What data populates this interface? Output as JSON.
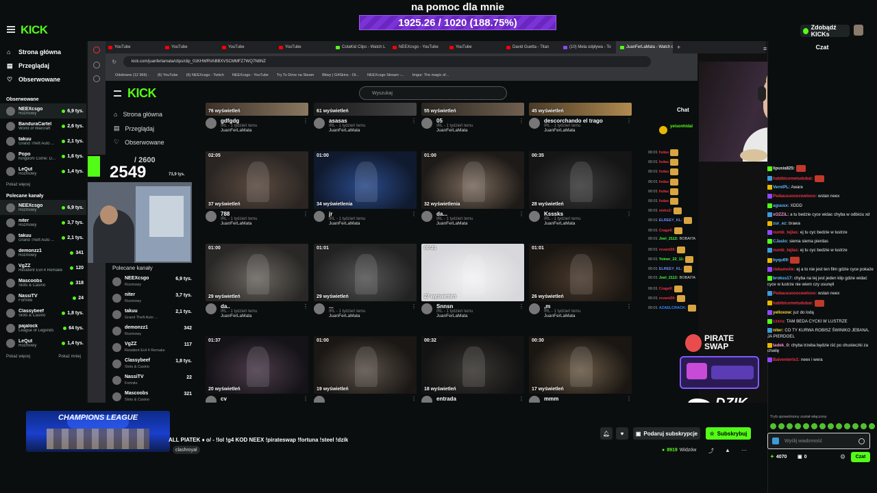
{
  "goal": {
    "title": "na pomoc dla mnie",
    "progress_text": "1925.26 / 1020 (188.75%)"
  },
  "topbar": {
    "logo": "KICK",
    "kicks_button": "Zdobądź KICKs"
  },
  "sidebar": {
    "nav": [
      {
        "label": "Strona główna",
        "icon": "home-icon"
      },
      {
        "label": "Przeglądaj",
        "icon": "browse-icon"
      },
      {
        "label": "Obserwowane",
        "icon": "heart-icon"
      }
    ],
    "followed_title": "Obserwowane",
    "followed": [
      {
        "name": "NEEXcsgo",
        "cat": "Rozmowy",
        "viewers": "6,9 tys.",
        "active": true
      },
      {
        "name": "BanduraCartel",
        "cat": "World of Warcraft",
        "viewers": "2,6 tys."
      },
      {
        "name": "takuu",
        "cat": "Grand Theft Auto ...",
        "viewers": "2,1 tys."
      },
      {
        "name": "Popo",
        "cat": "Kingdom Come: D...",
        "viewers": "1,6 tys."
      },
      {
        "name": "LeQut",
        "cat": "Rozmowy",
        "viewers": "1,4 tys."
      }
    ],
    "show_more": "Pokaż więcej",
    "recommended_title": "Polecane kanały",
    "recommended": [
      {
        "name": "NEEXcsgo",
        "cat": "Rozmowy",
        "viewers": "6,9 tys.",
        "active": true
      },
      {
        "name": "niter",
        "cat": "Rozmowy",
        "viewers": "3,7 tys."
      },
      {
        "name": "takuu",
        "cat": "Grand Theft Auto ...",
        "viewers": "2,1 tys."
      },
      {
        "name": "demonzz1",
        "cat": "Rozmowy",
        "viewers": "341"
      },
      {
        "name": "VgZZ",
        "cat": "Resident Evil 4 Remake",
        "viewers": "120"
      },
      {
        "name": "Mascoobs",
        "cat": "Slots & Casino",
        "viewers": "318"
      },
      {
        "name": "NassiTV",
        "cat": "Fortnite",
        "viewers": "24"
      },
      {
        "name": "Classybeef",
        "cat": "Slots & Casino",
        "viewers": "1,8 tys."
      },
      {
        "name": "pajalock",
        "cat": "League of Legends",
        "viewers": "64 tys."
      },
      {
        "name": "LeQut",
        "cat": "Rozmowy",
        "viewers": "1,4 tys."
      }
    ],
    "show_less": "Pokaż mniej"
  },
  "browser": {
    "tabs": [
      {
        "label": "YouTube",
        "fav": "r"
      },
      {
        "label": "YouTube",
        "fav": "r"
      },
      {
        "label": "YouTube",
        "fav": "r"
      },
      {
        "label": "YouTube",
        "fav": "r"
      },
      {
        "label": "CotaKid Clips - Watch L",
        "fav": "g"
      },
      {
        "label": "NEEXcsgo - YouTube",
        "fav": "r"
      },
      {
        "label": "YouTube",
        "fav": "r"
      },
      {
        "label": "David Guetta - Titan",
        "fav": "r"
      },
      {
        "label": "(10) Mela odpływa - To",
        "fav": "p"
      },
      {
        "label": "JuanFerLaMata - Watch c",
        "fav": "g",
        "active": true
      }
    ],
    "url": "kick.com/juanferlamata/clips/clip_01KHWRVABBXVSCMMFZ7WQ7N8NZ",
    "bookmarks": [
      "Odebrane (12 966) -",
      "(6) YouTube",
      "(6) NEEXcsgo - Twitch",
      "NEEXcsgo - YouTube",
      "Try To Drive na Steam",
      "Bitwy | G4Skins - Ot...",
      "NEEXcsgo Stream -...",
      "Imgur: The magic of..."
    ]
  },
  "inner": {
    "logo": "KICK",
    "search_placeholder": "Wyszukaj",
    "nav": [
      "Strona główna",
      "Przeglądaj",
      "Obserwowane"
    ],
    "rec_title": "Polecane kanały",
    "rec": [
      {
        "name": "NEEXcsgo",
        "cat": "Rozmowy",
        "viewers": "6,9 tys."
      },
      {
        "name": "niter",
        "cat": "Rozmowy",
        "viewers": "3,7 tys."
      },
      {
        "name": "takuu",
        "cat": "Grand Theft Auto ...",
        "viewers": "2,1 tys."
      },
      {
        "name": "demonzz1",
        "cat": "Rozmowy",
        "viewers": "342"
      },
      {
        "name": "VgZZ",
        "cat": "Resident Evil 4 Remake",
        "viewers": "117"
      },
      {
        "name": "Classybeef",
        "cat": "Slots & Casino",
        "viewers": "1,8 tys."
      },
      {
        "name": "NassiTV",
        "cat": "Fortnite",
        "viewers": "22"
      },
      {
        "name": "Mascoobs",
        "cat": "Slots & Casino",
        "viewers": "321"
      }
    ],
    "clips": [
      {
        "dur": "",
        "views": "76 wyświetleń",
        "title": "gdfgdg",
        "author": "JuanFerLaMata"
      },
      {
        "dur": "",
        "views": "61 wyświetleń",
        "title": "asasas",
        "author": "JuanFerLaMata"
      },
      {
        "dur": "",
        "views": "55 wyświetleń",
        "title": "05",
        "author": "JuanFerLaMata"
      },
      {
        "dur": "",
        "views": "45 wyświetleń",
        "title": "descorchando el trago",
        "author": "JuanFerLaMata"
      },
      {
        "dur": "02:05",
        "views": "37 wyświetleń",
        "title": "788",
        "author": "JuanFerLaMata"
      },
      {
        "dur": "01:00",
        "views": "34 wyświetlenia",
        "title": "jr",
        "author": "JuanFerLaMata"
      },
      {
        "dur": "01:00",
        "views": "32 wyświetlenia",
        "title": "da...",
        "author": "JuanFerLaMata"
      },
      {
        "dur": "00:35",
        "views": "28 wyświetleń",
        "title": "Ksssks",
        "author": "JuanFerLaMata"
      },
      {
        "dur": "01:00",
        "views": "29 wyświetleń",
        "title": "da..",
        "author": "JuanFerLaMata"
      },
      {
        "dur": "01:01",
        "views": "29 wyświetleń",
        "title": "...",
        "author": "JuanFerLaMata"
      },
      {
        "dur": "00:21",
        "views": "27 wyświetleń",
        "title": "Snnsn",
        "author": "JuanFerLaMata"
      },
      {
        "dur": "01:01",
        "views": "26 wyświetleń",
        "title": ",m",
        "author": "JuanFerLaMata"
      },
      {
        "dur": "01:37",
        "views": "20 wyświetleń",
        "title": "cv",
        "author": ""
      },
      {
        "dur": "01:00",
        "views": "19 wyświetleń",
        "title": "",
        "author": ""
      },
      {
        "dur": "00:32",
        "views": "18 wyświetleń",
        "title": "entrada",
        "author": ""
      },
      {
        "dur": "00:30",
        "views": "17 wyświetleń",
        "title": "mmm",
        "author": ""
      }
    ],
    "clip_sub": "IRL - 1 tydzień temu",
    "chat_title": "Chat",
    "chat_user": "yeisonhidal",
    "chat_lines": [
      {
        "t": "00:01",
        "u": "fsdas",
        "c": "#e34"
      },
      {
        "t": "00:01",
        "u": "fsdas",
        "c": "#e34"
      },
      {
        "t": "00:01",
        "u": "fsdas",
        "c": "#e34"
      },
      {
        "t": "00:01",
        "u": "fsdas",
        "c": "#e34"
      },
      {
        "t": "00:01",
        "u": "fsdas",
        "c": "#e34"
      },
      {
        "t": "00:01",
        "u": "fsdas",
        "c": "#e34"
      },
      {
        "t": "00:01",
        "u": "sieko2:",
        "c": "#e34"
      },
      {
        "t": "00:01",
        "u": "ELREEY_KL:",
        "c": "#6b8cff"
      },
      {
        "t": "00:01",
        "u": "Cragell:",
        "c": "#e34"
      },
      {
        "t": "00:01",
        "u": "Joel_2112:",
        "c": "#4f4",
        "text": "BOBAITA"
      },
      {
        "t": "00:01",
        "u": "revant26:",
        "c": "#e34"
      },
      {
        "t": "00:01",
        "u": "Yoiner_22_11:",
        "c": "#4f4"
      },
      {
        "t": "00:01",
        "u": "ELREEY_KL:",
        "c": "#6b8cff"
      },
      {
        "t": "00:01",
        "u": "Joel_2112:",
        "c": "#4f4",
        "text": "BOBAITA"
      },
      {
        "t": "00:01",
        "u": "Cragell:",
        "c": "#e34"
      },
      {
        "t": "00:01",
        "u": "revant26:",
        "c": "#e34"
      },
      {
        "t": "00:01",
        "u": "AZAELCRACK:",
        "c": "#38f"
      }
    ]
  },
  "overlay": {
    "count_small": "/ 2600",
    "count_big": "2549",
    "side_viewers": "73,9 tys.",
    "sponsor1": "PIRATE SWAP",
    "sponsor3": "DZIK",
    "cl_text": "CHAMPIONS LEAGUE"
  },
  "stream": {
    "title": "ALL PIATEK ♦ o/ - !lol !g4 KOD NEEX !pirateswap !fortuna !steel !dzik",
    "tag": "clashroyal",
    "gift_sub": "Podaruj subskrypcje",
    "subscribe": "Subskrybuj",
    "viewers": "8919",
    "viewers_label": "Widzów"
  },
  "chat": {
    "title": "Czat",
    "messages": [
      {
        "u": "lipusia825:",
        "c": "#e0e0e0",
        "text": ""
      },
      {
        "u": "habibicometudubai:",
        "c": "#e34",
        "text": ""
      },
      {
        "u": "VerniPL:",
        "c": "#6bf",
        "text": "Aware"
      },
      {
        "u": "Pedauuuooocwelooo:",
        "c": "#e34",
        "text": "wstan neex"
      },
      {
        "u": "aguusx:",
        "c": "#6bf",
        "text": "XDDD"
      },
      {
        "u": "xOZZiL:",
        "c": "#f9c",
        "text": "a tu bedzie cyce widac chyba w odbiciu xd"
      },
      {
        "u": "zur_ez:",
        "c": "#6bf",
        "text": "brawa"
      },
      {
        "u": "numb_tejlas:",
        "c": "#e34",
        "text": "ej tu cyc bedzie w lustrze"
      },
      {
        "u": "CJaslo:",
        "c": "#6bf",
        "text": "siema siema pierdas"
      },
      {
        "u": "numb_tejlas:",
        "c": "#e34",
        "text": "ej tu cyc bedzie w lustrze"
      },
      {
        "u": "byqu69:",
        "c": "#6bf",
        "text": ""
      },
      {
        "u": "riekamoiie:",
        "c": "#e34",
        "text": "ej a to nie jest ten film gdzie cyce pokaże"
      },
      {
        "u": "brokss17:",
        "c": "#6bf",
        "text": "chyba na tej jest jeden klip gdzie widać cyce w lustrze nie wiem czy usunęli"
      },
      {
        "u": "Pedauuuooocwelooo:",
        "c": "#e34",
        "text": "wstan neex"
      },
      {
        "u": "habibicometudubai:",
        "c": "#e34",
        "text": ""
      },
      {
        "u": "yelloxow:",
        "c": "#fd3",
        "text": "juz do lodą"
      },
      {
        "u": "czxru:",
        "c": "#e34",
        "text": "TAM BEDA CYCKI W LUSTRZE"
      },
      {
        "u": "niter:",
        "c": "#fd3",
        "text": "CO TY KURWA ROBISZ ŚWINIKO JEBANA, JA PIERDOEL"
      },
      {
        "u": "tadek_0:",
        "c": "#f9c",
        "text": "chyba trzeba będzie iść po chusteczki za chwilę"
      },
      {
        "u": "Balventerts1:",
        "c": "#e34",
        "text": "neex i wera"
      }
    ],
    "slow_notice": "Tryb spowolniony został włączony",
    "input_placeholder": "Wyślij wiadomość",
    "points": "4070",
    "gifts": "0",
    "send": "Czat"
  }
}
